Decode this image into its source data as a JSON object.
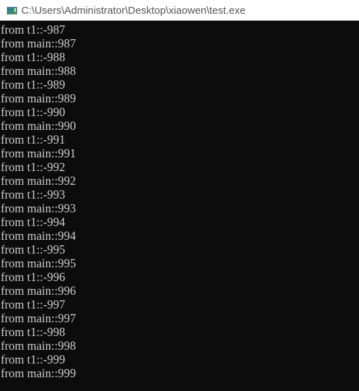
{
  "window": {
    "title": "C:\\Users\\Administrator\\Desktop\\xiaowen\\test.exe",
    "icon": "console-app-icon"
  },
  "console": {
    "lines": [
      "from t1::-987",
      "from main::987",
      "from t1::-988",
      "from main::988",
      "from t1::-989",
      "from main::989",
      "from t1::-990",
      "from main::990",
      "from t1::-991",
      "from main::991",
      "from t1::-992",
      "from main::992",
      "from t1::-993",
      "from main::993",
      "from t1::-994",
      "from main::994",
      "from t1::-995",
      "from main::995",
      "from t1::-996",
      "from main::996",
      "from t1::-997",
      "from main::997",
      "from t1::-998",
      "from main::998",
      "from t1::-999",
      "from main::999"
    ]
  },
  "colors": {
    "titlebar_bg": "#ffffff",
    "console_bg": "#0c0c0c",
    "console_fg": "#cccccc"
  }
}
